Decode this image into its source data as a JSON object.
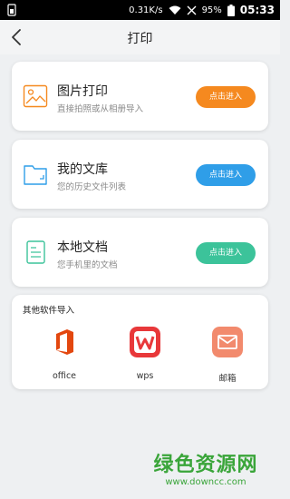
{
  "status_bar": {
    "speed": "0.31K/s",
    "battery": "95%",
    "time": "05:33"
  },
  "header": {
    "title": "打印"
  },
  "cards": [
    {
      "title": "图片打印",
      "subtitle": "直接拍照或从相册导入",
      "button": "点击进入",
      "color": "#f5891f"
    },
    {
      "title": "我的文库",
      "subtitle": "您的历史文件列表",
      "button": "点击进入",
      "color": "#2f9ee8"
    },
    {
      "title": "本地文档",
      "subtitle": "您手机里的文档",
      "button": "点击进入",
      "color": "#3cc39a"
    }
  ],
  "import_section": {
    "heading": "其他软件导入",
    "apps": [
      {
        "label": "office",
        "icon": "office-icon",
        "color": "#e3470f"
      },
      {
        "label": "wps",
        "icon": "wps-icon",
        "color": "#e8383a"
      },
      {
        "label": "邮箱",
        "icon": "mail-icon",
        "color": "#f28a6d"
      }
    ]
  },
  "watermark": {
    "cn": "绿色资源网",
    "en": "www.downcc.com"
  }
}
